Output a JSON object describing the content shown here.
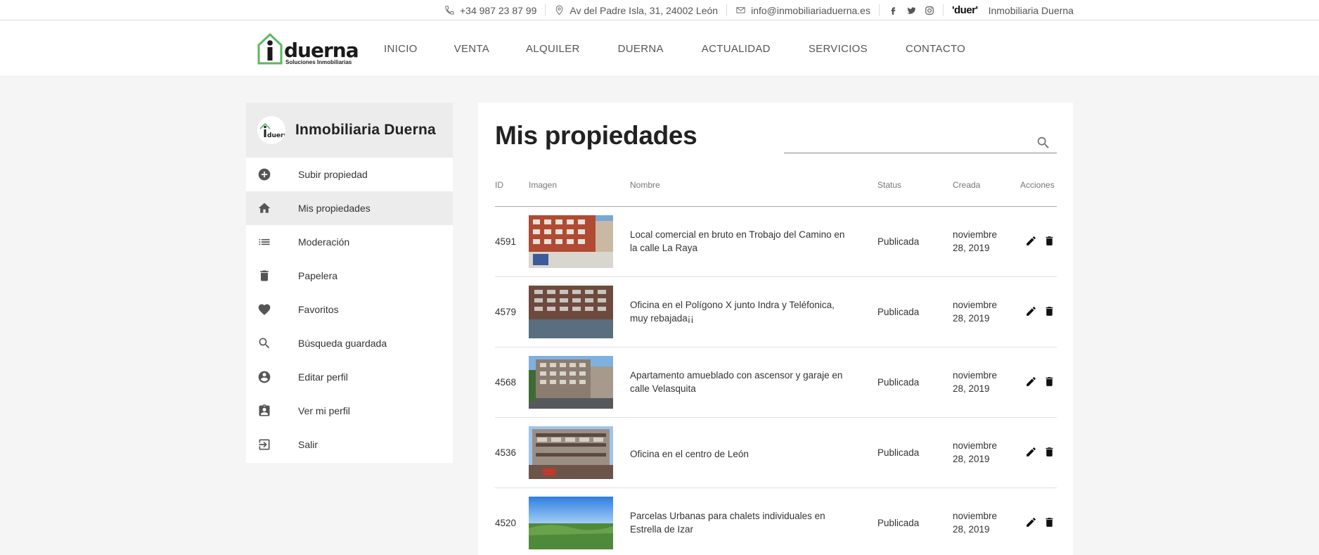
{
  "topbar": {
    "phone": "+34 987 23 87 99",
    "address": "Av del Padre Isla, 31, 24002 León",
    "email": "info@inmobiliariaduerna.es",
    "social": [
      "f",
      "t",
      "ig"
    ],
    "mini_logo": "'duer'",
    "brand_name": "Inmobiliaria Duerna"
  },
  "brand": {
    "logo_text": "duerna",
    "logo_sub": "Soluciones Inmobiliarias"
  },
  "nav": [
    "INICIO",
    "VENTA",
    "ALQUILER",
    "DUERNA",
    "ACTUALIDAD",
    "SERVICIOS",
    "CONTACTO"
  ],
  "sidebar": {
    "title": "Inmobiliaria Duerna",
    "items": [
      {
        "label": "Subir propiedad",
        "icon": "plus-circle-icon"
      },
      {
        "label": "Mis propiedades",
        "icon": "home-icon",
        "active": true
      },
      {
        "label": "Moderación",
        "icon": "list-icon"
      },
      {
        "label": "Papelera",
        "icon": "trash-icon"
      },
      {
        "label": "Favoritos",
        "icon": "heart-icon"
      },
      {
        "label": "Búsqueda guardada",
        "icon": "search-icon"
      },
      {
        "label": "Editar perfil",
        "icon": "account-circle-icon"
      },
      {
        "label": "Ver mi perfil",
        "icon": "assignment-ind-icon"
      },
      {
        "label": "Salir",
        "icon": "exit-icon"
      }
    ]
  },
  "main": {
    "title": "Mis propiedades",
    "search_placeholder": "",
    "columns": {
      "id": "ID",
      "image": "Imagen",
      "name": "Nombre",
      "status": "Status",
      "created": "Creada",
      "actions": "Acciones"
    },
    "rows": [
      {
        "id": "4591",
        "name": "Local comercial en bruto en Trobajo del Camino en la calle La Raya",
        "status": "Publicada",
        "date_line1": "noviembre",
        "date_line2": "28, 2019",
        "image": "brick-building"
      },
      {
        "id": "4579",
        "name": "Oficina en el Polígono X junto Indra y Teléfonica, muy rebajada¡¡",
        "status": "Publicada",
        "date_line1": "noviembre",
        "date_line2": "28, 2019",
        "image": "dark-building"
      },
      {
        "id": "4568",
        "name": "Apartamento amueblado con ascensor y garaje en calle Velasquita",
        "status": "Publicada",
        "date_line1": "noviembre",
        "date_line2": "28, 2019",
        "image": "street-building"
      },
      {
        "id": "4536",
        "name": "Oficina en el centro de León",
        "status": "Publicada",
        "date_line1": "noviembre",
        "date_line2": "28, 2019",
        "image": "corner-building"
      },
      {
        "id": "4520",
        "name": "Parcelas Urbanas para chalets individuales en Estrella de Izar",
        "status": "Publicada",
        "date_line1": "noviembre",
        "date_line2": "28, 2019",
        "image": "green-field"
      }
    ]
  },
  "colors": {
    "accent_green": "#5cb85c",
    "sidebar_active": "#ececec"
  }
}
